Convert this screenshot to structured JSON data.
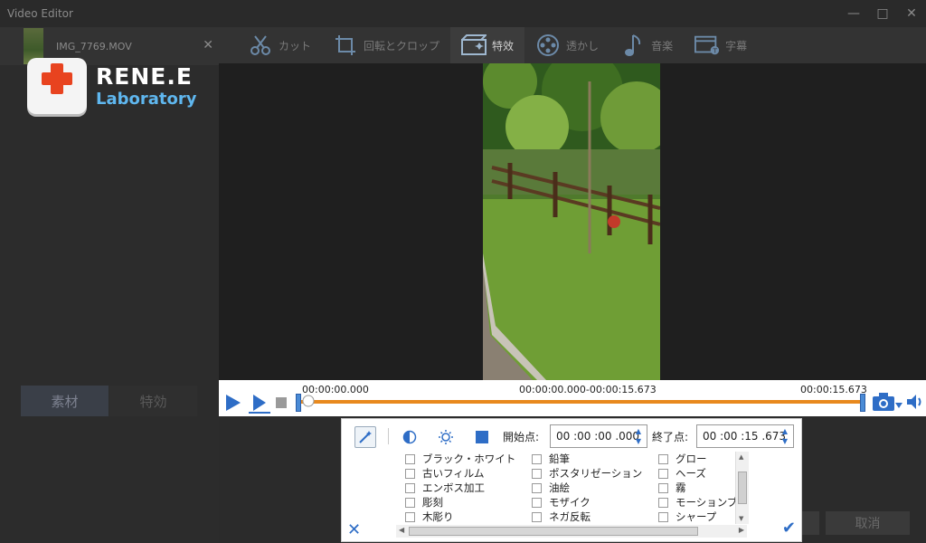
{
  "window": {
    "title": "Video Editor",
    "controls": [
      "minimize",
      "maximize",
      "close"
    ]
  },
  "file_tab": {
    "name": "IMG_7769.MOV"
  },
  "logo": {
    "line1": "RENE.E",
    "line2": "Laboratory"
  },
  "left_tabs": [
    {
      "label": "素材",
      "active": true
    },
    {
      "label": "特効",
      "active": false
    }
  ],
  "toolbar": {
    "items": [
      {
        "label": "カット",
        "icon": "scissors-icon",
        "active": false
      },
      {
        "label": "回転とクロップ",
        "icon": "crop-icon",
        "active": false
      },
      {
        "label": "特效",
        "icon": "effects-icon",
        "active": true
      },
      {
        "label": "透かし",
        "icon": "film-reel-icon",
        "active": false
      },
      {
        "label": "音楽",
        "icon": "music-note-icon",
        "active": false
      },
      {
        "label": "字幕",
        "icon": "subtitle-icon",
        "active": false
      }
    ]
  },
  "timeline": {
    "start": "00:00:00.000",
    "range": "00:00:00.000-00:00:15.673",
    "end": "00:00:15.673"
  },
  "effects_dialog": {
    "start_label": "開始点:",
    "start_value": "00 :00 :00 .000",
    "end_label": "終了点:",
    "end_value": "00 :00 :15 .673",
    "columns": [
      [
        "ブラック・ホワイト",
        "古いフィルム",
        "エンボス加工",
        "彫刻",
        "木彫り"
      ],
      [
        "鉛筆",
        "ポスタリゼーション",
        "油絵",
        "モザイク",
        "ネガ反転"
      ],
      [
        "グロー",
        "ヘーズ",
        "霧",
        "モーションブ",
        "シャープ"
      ]
    ]
  },
  "bottom_buttons": {
    "cancel": "取消"
  },
  "colors": {
    "accent": "#2e6dc6",
    "track": "#e8891e",
    "background": "#2b2b2b"
  }
}
